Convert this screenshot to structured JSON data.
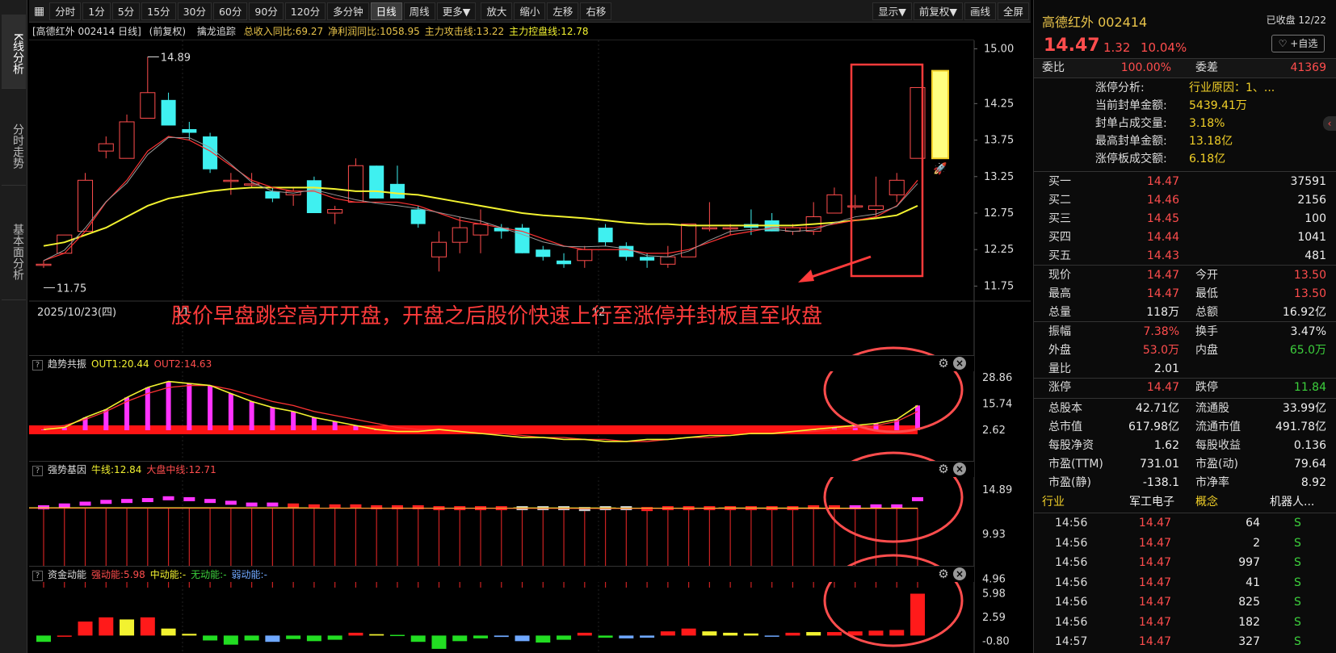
{
  "side_tabs": [
    {
      "label": "K线分析",
      "active": true
    },
    {
      "label": "分时走势",
      "active": false
    },
    {
      "label": "基本面分析",
      "active": false
    }
  ],
  "toolbar": {
    "periods": [
      "分时",
      "1分",
      "5分",
      "15分",
      "30分",
      "60分",
      "90分",
      "120分",
      "多分钟",
      "日线",
      "周线",
      "更多▼"
    ],
    "active": "日线",
    "actions": [
      "放大",
      "缩小",
      "左移",
      "右移"
    ],
    "right": [
      "显示▼",
      "前复权▼",
      "画线",
      "全屏"
    ]
  },
  "chart_head": {
    "name": "[高德红外 002414 日线]",
    "fq": "(前复权)",
    "indicator": "擒龙追踪",
    "items": [
      {
        "text": "总收入同比:69.27",
        "color": "#e8c34a"
      },
      {
        "text": "净利润同比:1058.95",
        "color": "#e8c34a"
      },
      {
        "text": "主力攻击线:13.22",
        "color": "#e8c34a"
      },
      {
        "text": "主力控盘线:12.78",
        "color": "#f2f230"
      }
    ]
  },
  "main_axis": [
    "15.00",
    "14.25",
    "13.75",
    "13.25",
    "12.75",
    "12.25",
    "11.75"
  ],
  "x_labels": [
    "2025/10/23(四)",
    "11",
    "12"
  ],
  "annotations": {
    "high": "14.89",
    "low": "11.75",
    "text": "股价早盘跳空高开开盘，开盘之后股价快速上行至涨停并封板直至收盘"
  },
  "sub1": {
    "name": "趋势共振",
    "items": [
      {
        "text": "OUT1:20.44",
        "color": "#f2f230"
      },
      {
        "text": "OUT2:14.63",
        "color": "#ff4d4d"
      }
    ],
    "axis": [
      "28.86",
      "15.74",
      "2.62"
    ]
  },
  "sub2": {
    "name": "强势基因",
    "items": [
      {
        "text": "牛线:12.84",
        "color": "#f2f230"
      },
      {
        "text": "大盘中线:12.71",
        "color": "#ff4d4d"
      }
    ],
    "axis": [
      "14.89",
      "9.93",
      "4.96"
    ]
  },
  "sub3": {
    "name": "资金动能",
    "items": [
      {
        "text": "强动能:5.98",
        "color": "#ff4d4d"
      },
      {
        "text": "中动能:-",
        "color": "#f2f230"
      },
      {
        "text": "无动能:-",
        "color": "#3ccf3c"
      },
      {
        "text": "弱动能:-",
        "color": "#6fa8ff"
      }
    ],
    "axis": [
      "5.98",
      "2.59",
      "-0.80"
    ]
  },
  "chart_data": {
    "type": "candlestick",
    "candles": [
      [
        12.05,
        12.05,
        12.0,
        12.1
      ],
      [
        12.2,
        12.45,
        12.2,
        12.45
      ],
      [
        12.5,
        13.2,
        12.5,
        13.3
      ],
      [
        13.6,
        13.7,
        13.5,
        13.8
      ],
      [
        13.5,
        14.0,
        13.5,
        14.1
      ],
      [
        14.05,
        14.4,
        14.05,
        14.89
      ],
      [
        14.3,
        13.95,
        13.95,
        14.4
      ],
      [
        13.9,
        13.85,
        13.75,
        14.0
      ],
      [
        13.8,
        13.35,
        13.3,
        13.85
      ],
      [
        13.2,
        13.2,
        13.0,
        13.3
      ],
      [
        13.15,
        13.15,
        13.1,
        13.3
      ],
      [
        13.05,
        12.95,
        12.9,
        13.1
      ],
      [
        13.0,
        13.05,
        12.85,
        13.1
      ],
      [
        13.2,
        12.75,
        12.75,
        13.25
      ],
      [
        12.75,
        12.8,
        12.6,
        12.85
      ],
      [
        12.9,
        13.4,
        12.9,
        13.5
      ],
      [
        13.4,
        12.95,
        12.95,
        13.4
      ],
      [
        13.15,
        12.95,
        12.95,
        13.4
      ],
      [
        12.8,
        12.6,
        12.55,
        12.85
      ],
      [
        12.15,
        12.35,
        11.95,
        12.5
      ],
      [
        12.35,
        12.55,
        12.2,
        12.7
      ],
      [
        12.45,
        12.6,
        12.2,
        12.8
      ],
      [
        12.55,
        12.5,
        12.4,
        12.6
      ],
      [
        12.55,
        12.2,
        12.2,
        12.6
      ],
      [
        12.25,
        12.15,
        12.1,
        12.3
      ],
      [
        12.1,
        12.05,
        12.0,
        12.2
      ],
      [
        12.1,
        12.25,
        12.0,
        12.3
      ],
      [
        12.55,
        12.35,
        12.3,
        12.6
      ],
      [
        12.3,
        12.15,
        12.1,
        12.35
      ],
      [
        12.15,
        12.1,
        12.0,
        12.2
      ],
      [
        12.05,
        12.15,
        12.0,
        12.3
      ],
      [
        12.15,
        12.6,
        12.15,
        12.6
      ],
      [
        12.55,
        12.55,
        12.5,
        12.9
      ],
      [
        12.55,
        12.55,
        12.45,
        12.6
      ],
      [
        12.6,
        12.55,
        12.45,
        12.8
      ],
      [
        12.65,
        12.5,
        12.5,
        12.75
      ],
      [
        12.5,
        12.55,
        12.45,
        12.6
      ],
      [
        12.5,
        12.7,
        12.45,
        12.9
      ],
      [
        12.75,
        13.0,
        12.75,
        13.1
      ],
      [
        12.85,
        12.85,
        12.8,
        13.0
      ],
      [
        12.8,
        12.85,
        12.7,
        13.25
      ],
      [
        13.0,
        13.2,
        12.9,
        13.3
      ],
      [
        13.5,
        14.47,
        13.5,
        14.47
      ]
    ],
    "ma_fast": [
      12.1,
      12.2,
      12.5,
      12.9,
      13.2,
      13.6,
      13.8,
      13.75,
      13.6,
      13.4,
      13.2,
      13.1,
      13.05,
      13.05,
      12.95,
      12.9,
      12.9,
      12.9,
      12.85,
      12.75,
      12.65,
      12.6,
      12.55,
      12.5,
      12.4,
      12.3,
      12.25,
      12.25,
      12.25,
      12.2,
      12.2,
      12.25,
      12.35,
      12.45,
      12.5,
      12.55,
      12.55,
      12.55,
      12.6,
      12.65,
      12.7,
      12.85,
      13.2
    ],
    "ma_slow": [
      12.3,
      12.35,
      12.45,
      12.55,
      12.7,
      12.85,
      12.95,
      13.0,
      13.05,
      13.08,
      13.1,
      13.1,
      13.1,
      13.1,
      13.08,
      13.05,
      13.05,
      13.02,
      13.0,
      12.95,
      12.9,
      12.85,
      12.8,
      12.75,
      12.72,
      12.7,
      12.68,
      12.65,
      12.62,
      12.6,
      12.6,
      12.58,
      12.58,
      12.58,
      12.58,
      12.58,
      12.58,
      12.6,
      12.62,
      12.65,
      12.68,
      12.72,
      12.85
    ],
    "ylim": [
      11.6,
      15.05
    ]
  },
  "quote": {
    "title": "高德红外 002414",
    "closed": "已收盘 12/22",
    "price": "14.47",
    "change": "1.32",
    "pct": "10.04%",
    "watch": "+自选",
    "wb": {
      "label": "委比",
      "value": "100.00%",
      "label2": "委差",
      "value2": "41369"
    },
    "limit_analysis": [
      {
        "k": "涨停分析:",
        "v": "行业原因：1、..."
      },
      {
        "k": "当前封单金额:",
        "v": "5439.41万"
      },
      {
        "k": "封单占成交量:",
        "v": "3.18%"
      },
      {
        "k": "最高封单金额:",
        "v": "13.18亿"
      },
      {
        "k": "涨停板成交额:",
        "v": "6.18亿"
      }
    ],
    "bids": [
      {
        "k": "买一",
        "p": "14.47",
        "v": "37591"
      },
      {
        "k": "买二",
        "p": "14.46",
        "v": "2156"
      },
      {
        "k": "买三",
        "p": "14.45",
        "v": "100"
      },
      {
        "k": "买四",
        "p": "14.44",
        "v": "1041"
      },
      {
        "k": "买五",
        "p": "14.43",
        "v": "481"
      }
    ],
    "stats1": [
      {
        "k": "现价",
        "v": "14.47",
        "c": "red",
        "k2": "今开",
        "v2": "13.50",
        "c2": "red"
      },
      {
        "k": "最高",
        "v": "14.47",
        "c": "red",
        "k2": "最低",
        "v2": "13.50",
        "c2": "red"
      },
      {
        "k": "总量",
        "v": "118万",
        "c": "wht",
        "k2": "总额",
        "v2": "16.92亿",
        "c2": "wht"
      }
    ],
    "stats2": [
      {
        "k": "振幅",
        "v": "7.38%",
        "c": "red",
        "k2": "换手",
        "v2": "3.47%",
        "c2": "wht"
      },
      {
        "k": "外盘",
        "v": "53.0万",
        "c": "red",
        "k2": "内盘",
        "v2": "65.0万",
        "c2": "grn"
      },
      {
        "k": "量比",
        "v": "2.01",
        "c": "wht",
        "k2": "",
        "v2": "",
        "c2": "wht"
      }
    ],
    "limits": {
      "k": "涨停",
      "v": "14.47",
      "k2": "跌停",
      "v2": "11.84"
    },
    "fund": [
      {
        "k": "总股本",
        "v": "42.71亿",
        "k2": "流通股",
        "v2": "33.99亿"
      },
      {
        "k": "总市值",
        "v": "617.98亿",
        "k2": "流通市值",
        "v2": "491.78亿"
      },
      {
        "k": "每股净资",
        "v": "1.62",
        "k2": "每股收益",
        "v2": "0.136"
      },
      {
        "k": "市盈(TTM)",
        "v": "731.01",
        "k2": "市盈(动)",
        "v2": "79.64"
      },
      {
        "k": "市盈(静)",
        "v": "-138.1",
        "k2": "市净率",
        "v2": "8.92"
      }
    ],
    "industry": {
      "k": "行业",
      "v": "军工电子",
      "k2": "概念",
      "v2": "机器人..."
    },
    "ticks": [
      {
        "t": "14:56",
        "p": "14.47",
        "v": "64",
        "s": "S"
      },
      {
        "t": "14:56",
        "p": "14.47",
        "v": "2",
        "s": "S"
      },
      {
        "t": "14:56",
        "p": "14.47",
        "v": "997",
        "s": "S"
      },
      {
        "t": "14:56",
        "p": "14.47",
        "v": "41",
        "s": "S"
      },
      {
        "t": "14:56",
        "p": "14.47",
        "v": "825",
        "s": "S"
      },
      {
        "t": "14:56",
        "p": "14.47",
        "v": "182",
        "s": "S"
      },
      {
        "t": "14:57",
        "p": "14.47",
        "v": "327",
        "s": "S"
      }
    ]
  }
}
